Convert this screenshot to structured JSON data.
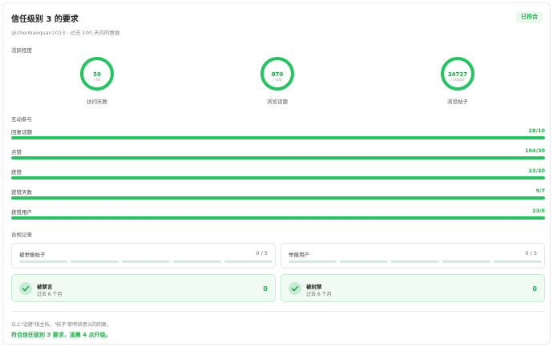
{
  "header": {
    "title": "信任级别 3 的要求",
    "badge": "已符合",
    "subtitle": "@chenbaoquan1013 · 过去 100 天内的数据"
  },
  "activity": {
    "label": "活跃程度",
    "gauges": [
      {
        "value": "50",
        "max": "/ 50",
        "label": "访问天数",
        "fraction": 1.0
      },
      {
        "value": "870",
        "max": "/ 500",
        "label": "浏览话题",
        "fraction": 1.0
      },
      {
        "value": "24727",
        "max": "/ 20000",
        "label": "浏览帖子",
        "fraction": 1.0
      }
    ]
  },
  "interaction": {
    "label": "互动参与",
    "bars": [
      {
        "name": "回复话题",
        "count": "28/10",
        "fraction": 1.0
      },
      {
        "name": "点赞",
        "count": "104/30",
        "fraction": 1.0
      },
      {
        "name": "获赞",
        "count": "23/20",
        "fraction": 1.0
      },
      {
        "name": "获赞天数",
        "count": "9/7",
        "fraction": 1.0
      },
      {
        "name": "获赞用户",
        "count": "23/5",
        "fraction": 1.0
      }
    ]
  },
  "compliance": {
    "label": "合规记录",
    "flagged": {
      "title": "被举报帖子",
      "count": "0 / 5"
    },
    "reported": {
      "title": "举报用户",
      "count": "0 / 5"
    },
    "silenced": {
      "title": "被禁言",
      "sub": "过去 6 个月",
      "value": "0"
    },
    "suspended": {
      "title": "被封禁",
      "sub": "过去 6 个月",
      "value": "0"
    }
  },
  "footer": {
    "note": "以上\"话题\"指主帖，\"帖子\"即传统意义的回复。",
    "summary": "符合信任级别 3 要求，凌晨 4 点升级。"
  },
  "colors": {
    "accent": "#22c55e",
    "accent_text": "#22b14c",
    "track": "#dff3e4"
  }
}
